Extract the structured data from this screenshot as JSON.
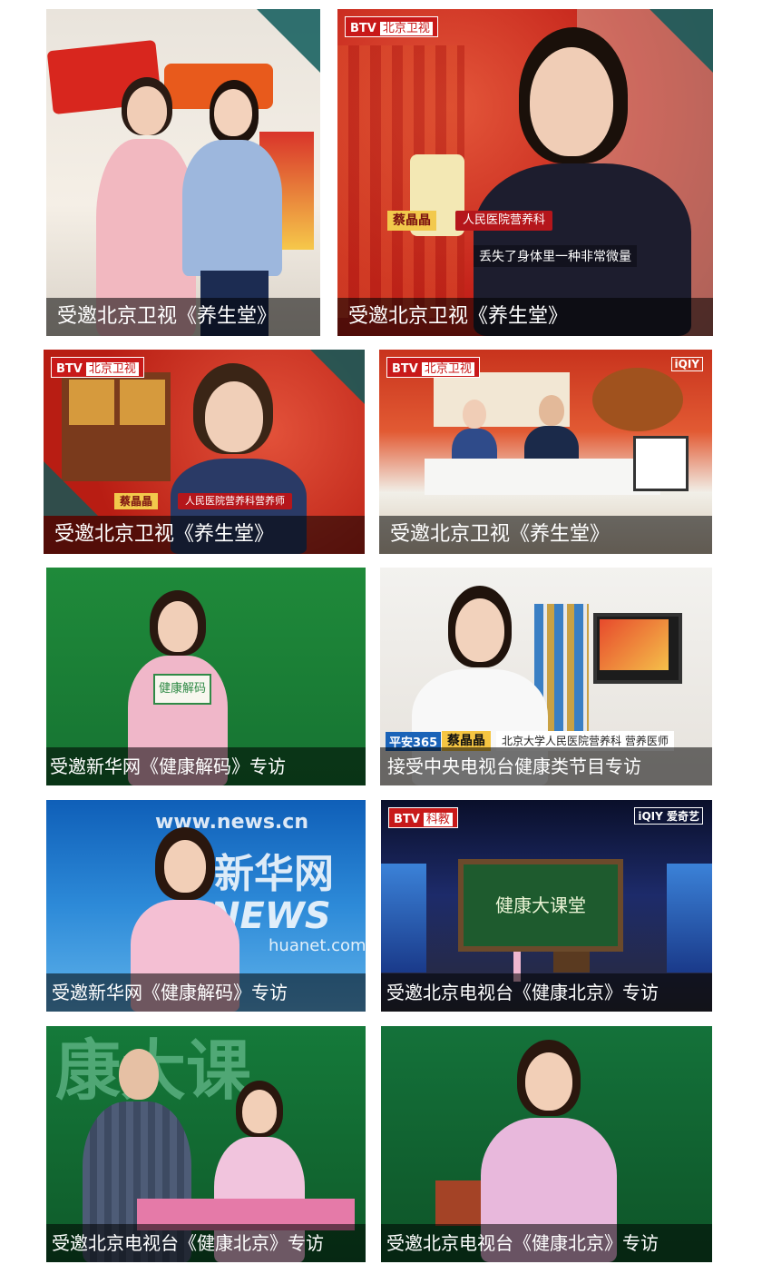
{
  "tiles": [
    {
      "caption": "受邀北京卫视《养生堂》"
    },
    {
      "caption": "受邀北京卫视《养生堂》",
      "logo": "BTV",
      "channel": "北京卫视",
      "lower_name": "蔡晶晶",
      "lower_title": "人民医院营养科",
      "subtitle": "丢失了身体里一种非常微量"
    },
    {
      "caption": "受邀北京卫视《养生堂》",
      "logo": "BTV",
      "channel": "北京卫视",
      "lower_name": "蔡晶晶",
      "lower_title": "人民医院营养科营养师"
    },
    {
      "caption": "受邀北京卫视《养生堂》",
      "logo": "BTV",
      "channel": "北京卫视",
      "corner_brand": "iQIY"
    },
    {
      "caption": "受邀新华网《健康解码》专访",
      "sign_text": "健康解码"
    },
    {
      "caption": "接受中央电视台健康类节目专访",
      "badge": "平安365",
      "lower_name": "蔡晶晶",
      "lower_title": "北京大学人民医院营养科 营养医师"
    },
    {
      "caption": "受邀新华网《健康解码》专访",
      "watermark_url": "www.news.cn",
      "brand": "新华网",
      "brand_sub": "NEWS",
      "url_tail": "huanet.com"
    },
    {
      "caption": "受邀北京电视台《健康北京》专访",
      "logo": "BTV",
      "channel": "科教",
      "corner_brand": "iQIY 爱奇艺",
      "board_text": "健康大课堂"
    },
    {
      "caption": "受邀北京电视台《健康北京》专访",
      "bg_text": "康大课"
    },
    {
      "caption": "受邀北京电视台《健康北京》专访"
    }
  ]
}
